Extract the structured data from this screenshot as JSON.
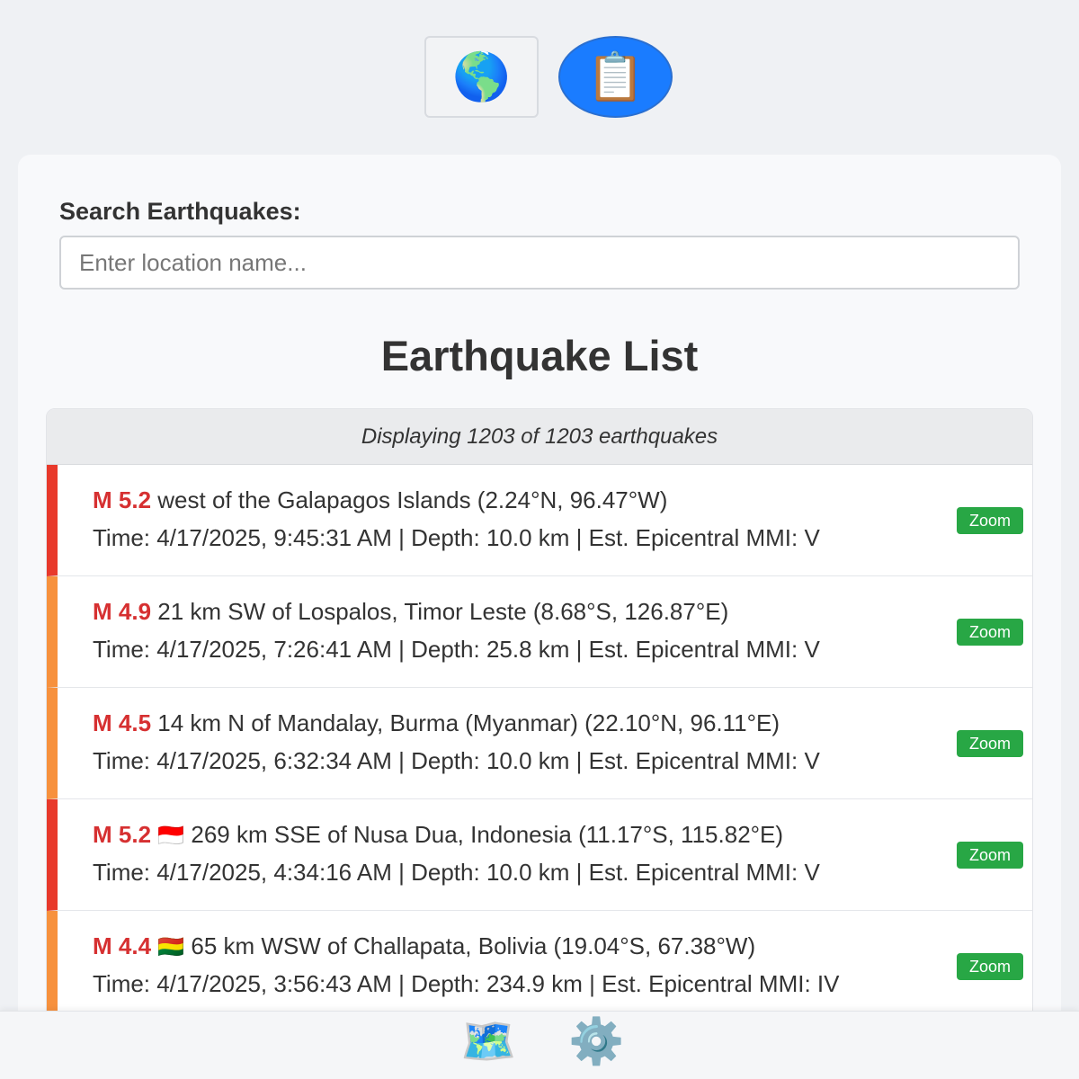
{
  "top_toggle": {
    "globe_icon": "🌎",
    "list_icon": "📋"
  },
  "search": {
    "label": "Search Earthquakes:",
    "placeholder": "Enter location name..."
  },
  "list": {
    "title": "Earthquake List",
    "summary": "Displaying 1203 of 1203 earthquakes",
    "zoom_label": "Zoom",
    "items": [
      {
        "mag": "M 5.2",
        "flag": "",
        "place": "west of the Galapagos Islands (2.24°N, 96.47°W)",
        "details": "Time: 4/17/2025, 9:45:31 AM | Depth: 10.0 km | Est. Epicentral MMI: V",
        "color": "#e8392b"
      },
      {
        "mag": "M 4.9",
        "flag": "",
        "place": "21 km SW of Lospalos, Timor Leste (8.68°S, 126.87°E)",
        "details": "Time: 4/17/2025, 7:26:41 AM | Depth: 25.8 km | Est. Epicentral MMI: V",
        "color": "#f7913d"
      },
      {
        "mag": "M 4.5",
        "flag": "",
        "place": "14 km N of Mandalay, Burma (Myanmar) (22.10°N, 96.11°E)",
        "details": "Time: 4/17/2025, 6:32:34 AM | Depth: 10.0 km | Est. Epicentral MMI: V",
        "color": "#f7913d"
      },
      {
        "mag": "M 5.2",
        "flag": "🇮🇩",
        "place": "269 km SSE of Nusa Dua, Indonesia (11.17°S, 115.82°E)",
        "details": "Time: 4/17/2025, 4:34:16 AM | Depth: 10.0 km | Est. Epicentral MMI: V",
        "color": "#e8392b"
      },
      {
        "mag": "M 4.4",
        "flag": "🇧🇴",
        "place": "65 km WSW of Challapata, Bolivia (19.04°S, 67.38°W)",
        "details": "Time: 4/17/2025, 3:56:43 AM | Depth: 234.9 km | Est. Epicentral MMI: IV",
        "color": "#f7913d"
      }
    ]
  },
  "bottom_bar": {
    "map_icon": "🗺️",
    "settings_icon": "⚙️"
  },
  "colors": {
    "accent": "#1a7cff",
    "magnitude": "#d63031",
    "zoom_button": "#28a745"
  }
}
